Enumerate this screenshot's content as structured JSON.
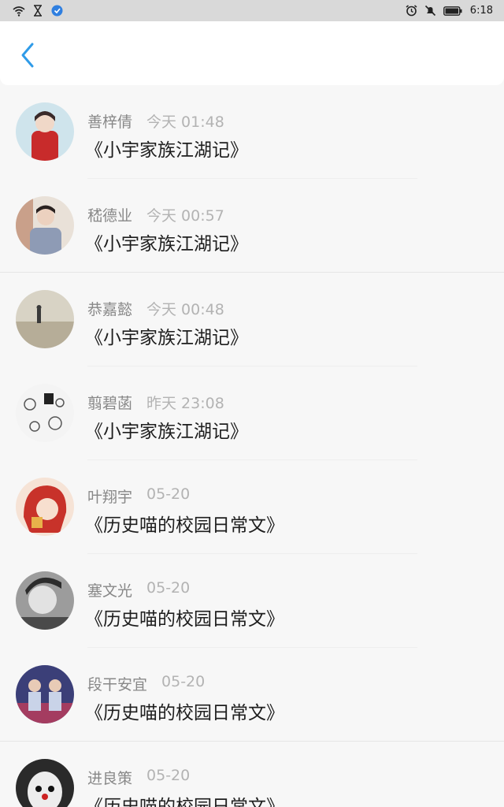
{
  "status_bar": {
    "time": "6:18",
    "icons_left": [
      "wifi-icon",
      "hourglass-icon",
      "app-badge-icon"
    ],
    "icons_right": [
      "alarm-icon",
      "mute-icon",
      "battery-icon"
    ]
  },
  "header": {
    "back_icon": "chevron-left-icon",
    "accent": "#2f9be8"
  },
  "items": [
    {
      "name": "善梓倩",
      "time": "今天 01:48",
      "book": "《小宇家族江湖记》"
    },
    {
      "name": "嵇德业",
      "time": "今天 00:57",
      "book": "《小宇家族江湖记》"
    },
    {
      "name": "恭嘉懿",
      "time": "今天 00:48",
      "book": "《小宇家族江湖记》"
    },
    {
      "name": "翦碧菡",
      "time": "昨天 23:08",
      "book": "《小宇家族江湖记》"
    },
    {
      "name": "叶翔宇",
      "time": "05-20",
      "book": "《历史喵的校园日常文》"
    },
    {
      "name": "塞文光",
      "time": "05-20",
      "book": "《历史喵的校园日常文》"
    },
    {
      "name": "段干安宜",
      "time": "05-20",
      "book": "《历史喵的校园日常文》"
    },
    {
      "name": "进良策",
      "time": "05-20",
      "book": "《历史喵的校园日常文》"
    }
  ]
}
